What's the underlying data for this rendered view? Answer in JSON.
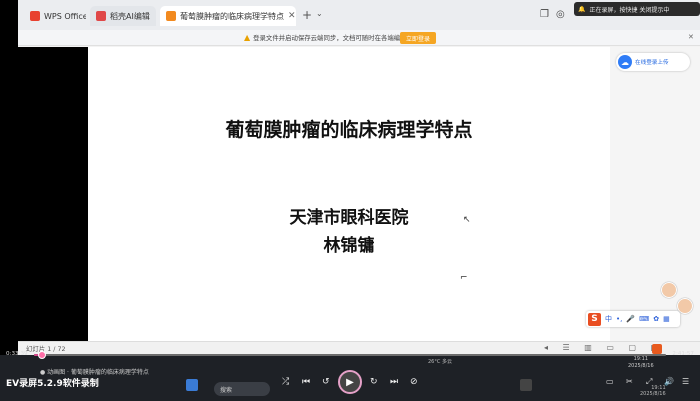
{
  "browser": {
    "tabs": [
      {
        "label": "WPS Office",
        "color": "#e8412f"
      },
      {
        "label": "稻壳AI编辑",
        "color": "#e04848"
      },
      {
        "label": "葡萄膜肿瘤的临床病理学特点",
        "color": "#f28a1f"
      }
    ],
    "new_tab": "+",
    "dropdown": "⌄"
  },
  "notification": {
    "text": "正在录屏，按快捷 关闭提示中"
  },
  "infobar": {
    "message": "登录文件并启动保存云端同步，文档可随时在各端编辑",
    "login_label": "立即登录"
  },
  "slide": {
    "title": "葡萄膜肿瘤的临床病理学特点",
    "organization": "天津市眼科医院",
    "author": "林锦镛"
  },
  "side_button": {
    "label": "在线登录上传"
  },
  "ime": {
    "mode": "中",
    "punct": "•,"
  },
  "status": {
    "slide_count": "幻灯片 1 / 72"
  },
  "taskbar": {
    "search_placeholder": "搜索",
    "weather": "26°C 多云",
    "clock_time": "19:11",
    "clock_date": "2025/8/16",
    "clock2_time": "19:11",
    "clock2_date": "2025/8/16"
  },
  "player": {
    "current_time": "0:33:39",
    "total_time": "2:41:57",
    "progress": 0.013,
    "overlay_task": "● 动画图 · 葡萄膜肿瘤的临床病理学特点",
    "brand": "EV录屏5.2.9软件录制"
  },
  "colors": {
    "accent": "#f5a623",
    "progress_fill": "#d04a8a",
    "slide_bg": "#ffffff"
  }
}
